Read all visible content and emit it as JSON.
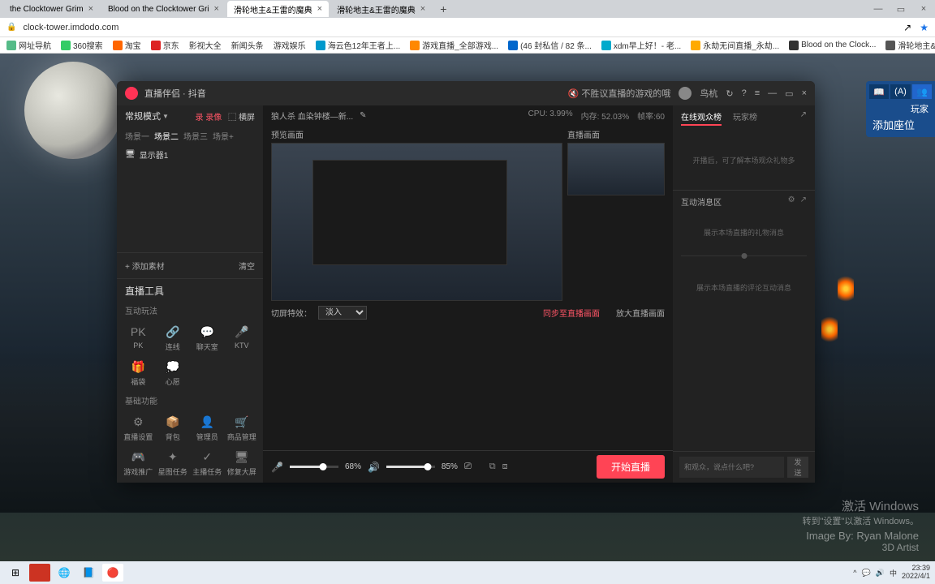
{
  "browser": {
    "tabs": [
      {
        "title": "the Clocktower Grim"
      },
      {
        "title": "Blood on the Clocktower Gri"
      },
      {
        "title": "滑轮地主&王雷的魔典"
      },
      {
        "title": "滑轮地主&王雷的魔典"
      }
    ],
    "url": "clock-tower.imdodo.com",
    "bookmarks": [
      "网址导航",
      "360搜索",
      "淘宝",
      "京东",
      "影视大全",
      "新闻头条",
      "游戏娱乐",
      "海云色12年王者上...",
      "游戏直播_全部游戏...",
      "(46 封私信 / 82 条...",
      "xdm早上好！- 老...",
      "永劫无间直播_永劫...",
      "Blood on the Clock...",
      "滑轮地主&王雷的..."
    ]
  },
  "sideWidget": {
    "label1": "玩家",
    "label2": "添加座位"
  },
  "app": {
    "title": "直播伴侣 · 抖音",
    "muteHint": "不胜议直播的游戏的哦",
    "user": "鸟杭",
    "mode": "常规模式",
    "chip_record": "录 录像",
    "chip_full": "⬚ 横屏",
    "scenes": [
      "场景一",
      "场景二",
      "场景三",
      "场景+"
    ],
    "activeSceneIx": 1,
    "source": "显示器1",
    "addSource": "+ 添加素材",
    "clear": "清空",
    "toolsTitle": "直播工具",
    "sec1": "互动玩法",
    "row1": [
      {
        "icon": "PK",
        "label": "PK"
      },
      {
        "icon": "🔗",
        "label": "连线"
      },
      {
        "icon": "💬",
        "label": "聊天室"
      },
      {
        "icon": "🎤",
        "label": "KTV"
      }
    ],
    "row2": [
      {
        "icon": "🎁",
        "label": "福袋"
      },
      {
        "icon": "💭",
        "label": "心愿"
      }
    ],
    "sec2": "基础功能",
    "row3": [
      {
        "icon": "⚙",
        "label": "直播设置"
      },
      {
        "icon": "📦",
        "label": "背包"
      },
      {
        "icon": "👤",
        "label": "管理员"
      },
      {
        "icon": "🛒",
        "label": "商品管理"
      }
    ],
    "row4": [
      {
        "icon": "🎮",
        "label": "游戏推广"
      },
      {
        "icon": "✦",
        "label": "星图任务"
      },
      {
        "icon": "✓",
        "label": "主播任务"
      },
      {
        "icon": "🖥",
        "label": "修复大屏"
      }
    ],
    "gameLine": "狼人杀 血染钟楼—新...",
    "stats": {
      "cpu": "CPU: 3.99%",
      "mem": "内存: 52.03%",
      "fps": "帧率:60"
    },
    "previewLabel": "预览画面",
    "liveLabel": "直播画面",
    "effectLabel": "切屏特效：",
    "effectValue": "淡入",
    "syncLabel": "同步至直播画面",
    "zoomLabel": "放大直播画面",
    "micPct": "68%",
    "spkPct": "85%",
    "startBtn": "开始直播",
    "rTabs": [
      "在线观众榜",
      "玩家榜"
    ],
    "rHint1": "开播后，可了解本场观众礼物多",
    "rSection": "互动消息区",
    "rGift": "展示本场直播的礼物消息",
    "rComment": "展示本场直播的评论互动消息",
    "rPlaceholder": "和观众，说点什么吧?",
    "rSend": "发送"
  },
  "watermark": {
    "l1": "激活 Windows",
    "l2": "转到\"设置\"以激活 Windows。",
    "l3": "Image By: Ryan Malone",
    "l4": "3D Artist"
  },
  "taskbar": {
    "time": "23:39",
    "date": "2022/4/1"
  }
}
